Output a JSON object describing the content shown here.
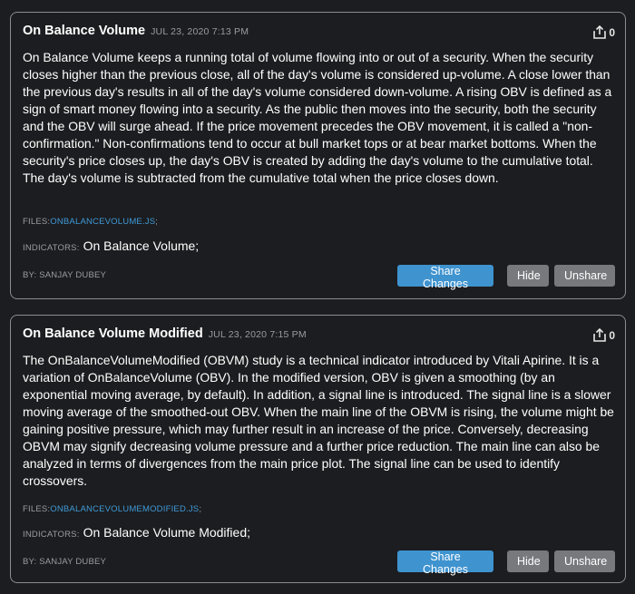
{
  "cards": [
    {
      "title": "On Balance Volume",
      "date": "JUL 23, 2020 7:13 PM",
      "share_count": "0",
      "description": "On Balance Volume keeps a running total of volume flowing into or out of a security. When the security closes higher than the previous close, all of the day's volume is considered up-volume. A close lower than the previous day's results in all of the day's volume considered down-volume. A rising OBV is defined as a sign of smart money flowing into a security. As the public then moves into the security, both the security and the OBV will surge ahead. If the price movement precedes the OBV movement, it is called a \"non-confirmation.\" Non-confirmations tend to occur at bull market tops or at bear market bottoms. When the security's price closes up, the day's OBV is created by adding the day's volume to the cumulative total. The day's volume is subtracted from the cumulative total when the price closes down.",
      "files_label": "FILES:",
      "file_name": "ONBALANCEVOLUME.JS",
      "files_suffix": ";",
      "indicators_label": "INDICATORS:",
      "indicators_value": "On Balance Volume;",
      "author": "BY: SANJAY DUBEY",
      "share_changes_label": "Share Changes",
      "hide_label": "Hide",
      "unshare_label": "Unshare"
    },
    {
      "title": "On Balance Volume Modified",
      "date": "JUL 23, 2020 7:15 PM",
      "share_count": "0",
      "description": "The OnBalanceVolumeModified (OBVM) study is a technical indicator introduced by Vitali Apirine. It is a variation of OnBalanceVolume (OBV). In the modified version, OBV is given a smoothing (by an exponential moving average, by default). In addition, a signal line is introduced. The signal line is a slower moving average of the smoothed-out OBV. When the main line of the OBVM is rising, the volume might be gaining positive pressure, which may further result in an increase of the price. Conversely, decreasing OBVM may signify decreasing volume pressure and a further price reduction. The main line can also be analyzed in terms of divergences from the main price plot. The signal line can be used to identify crossovers.",
      "files_label": "FILES:",
      "file_name": "ONBALANCEVOLUMEMODIFIED.JS",
      "files_suffix": ";",
      "indicators_label": "INDICATORS:",
      "indicators_value": "On Balance Volume Modified;",
      "author": "BY: SANJAY DUBEY",
      "share_changes_label": "Share Changes",
      "hide_label": "Hide",
      "unshare_label": "Unshare"
    }
  ],
  "icons": {
    "share": "share-icon"
  },
  "colors": {
    "background": "#1c1d20",
    "card_border": "#8a8c90",
    "link": "#3f9ad8",
    "primary_button": "#3f93cf",
    "secondary_button": "#77797d",
    "muted_text": "#9a9ca0"
  }
}
